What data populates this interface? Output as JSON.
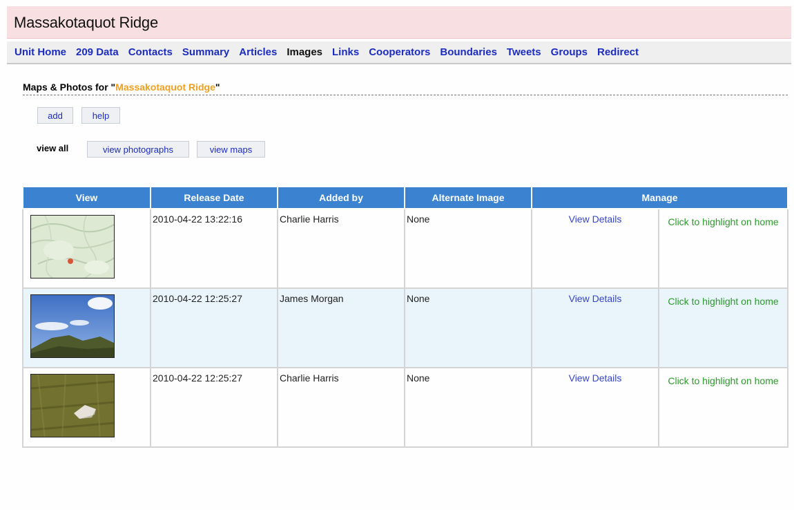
{
  "header": {
    "title": "Massakotaquot Ridge"
  },
  "nav": {
    "items": [
      {
        "label": "Unit Home"
      },
      {
        "label": "209 Data"
      },
      {
        "label": "Contacts"
      },
      {
        "label": "Summary"
      },
      {
        "label": "Articles"
      },
      {
        "label": "Images",
        "active": true
      },
      {
        "label": "Links"
      },
      {
        "label": "Cooperators"
      },
      {
        "label": "Boundaries"
      },
      {
        "label": "Tweets"
      },
      {
        "label": "Groups"
      },
      {
        "label": "Redirect"
      }
    ]
  },
  "section": {
    "heading_prefix": "Maps & Photos for \"",
    "unit_name": "Massakotaquot Ridge",
    "heading_suffix": "\""
  },
  "actions": {
    "add_label": "add",
    "help_label": "help"
  },
  "filters": {
    "view_all_label": "view all",
    "view_photographs_label": "view photographs",
    "view_maps_label": "view maps"
  },
  "table": {
    "headers": {
      "view": "View",
      "release_date": "Release Date",
      "added_by": "Added by",
      "alternate_image": "Alternate Image",
      "manage": "Manage"
    },
    "rows": [
      {
        "thumb": "map-thumbnail",
        "release_date": "2010-04-22 13:22:16",
        "added_by": "Charlie Harris",
        "alternate_image": "None",
        "details": "View Details",
        "highlight": "Click to highlight on home"
      },
      {
        "thumb": "ridge-photo-thumbnail",
        "release_date": "2010-04-22 12:25:27",
        "added_by": "James Morgan",
        "alternate_image": "None",
        "details": "View Details",
        "highlight": "Click to highlight on home"
      },
      {
        "thumb": "rock-photo-thumbnail",
        "release_date": "2010-04-22 12:25:27",
        "added_by": "Charlie Harris",
        "alternate_image": "None",
        "details": "View Details",
        "highlight": "Click to highlight on home"
      }
    ]
  },
  "colors": {
    "header_bg": "#f8e0e2",
    "nav_link": "#1c2cc0",
    "table_header_bg": "#3b83d1",
    "unit_name": "#f0a020",
    "highlight_link": "#2a9a2a",
    "alt_row_bg": "#eaf4fb"
  }
}
